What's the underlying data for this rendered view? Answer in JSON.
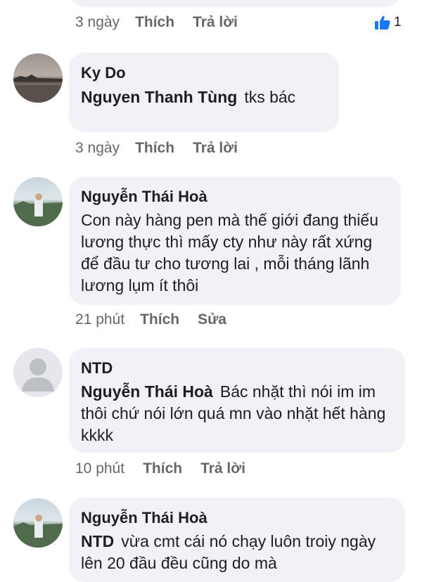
{
  "comments": [
    {
      "time": "3 ngày",
      "like": "Thích",
      "reply": "Trả lời",
      "like_count": "1"
    },
    {
      "author": "Ky Do",
      "mention": "Nguyen Thanh Tùng",
      "text": "tks bác",
      "time": "3 ngày",
      "like": "Thích",
      "reply": "Trả lời"
    },
    {
      "author": "Nguyễn Thái Hoà",
      "text": "Con này hàng pen mà thế giới đang thiếu lương thực thì mấy cty như này rất xứng để đầu tư cho tương lai , mỗi tháng lãnh lương lụm ít thôi",
      "time": "21 phút",
      "like": "Thích",
      "edit": "Sửa"
    },
    {
      "author": "NTD",
      "mention": "Nguyễn Thái Hoà",
      "text": "Bác nhặt thì nói im im thôi chứ nói lớn quá mn vào nhặt hết hàng kkkk",
      "time": "10 phút",
      "like": "Thích",
      "reply": "Trả lời"
    },
    {
      "author": "Nguyễn Thái Hoà",
      "mention": "NTD",
      "text": "vừa cmt cái nó chạy luôn troiy ngày lên 20 đầu đều cũng do mà"
    }
  ],
  "colors": {
    "bubble": "#f0f2f5",
    "meta": "#65676b",
    "like_blue": "#1877f2"
  }
}
